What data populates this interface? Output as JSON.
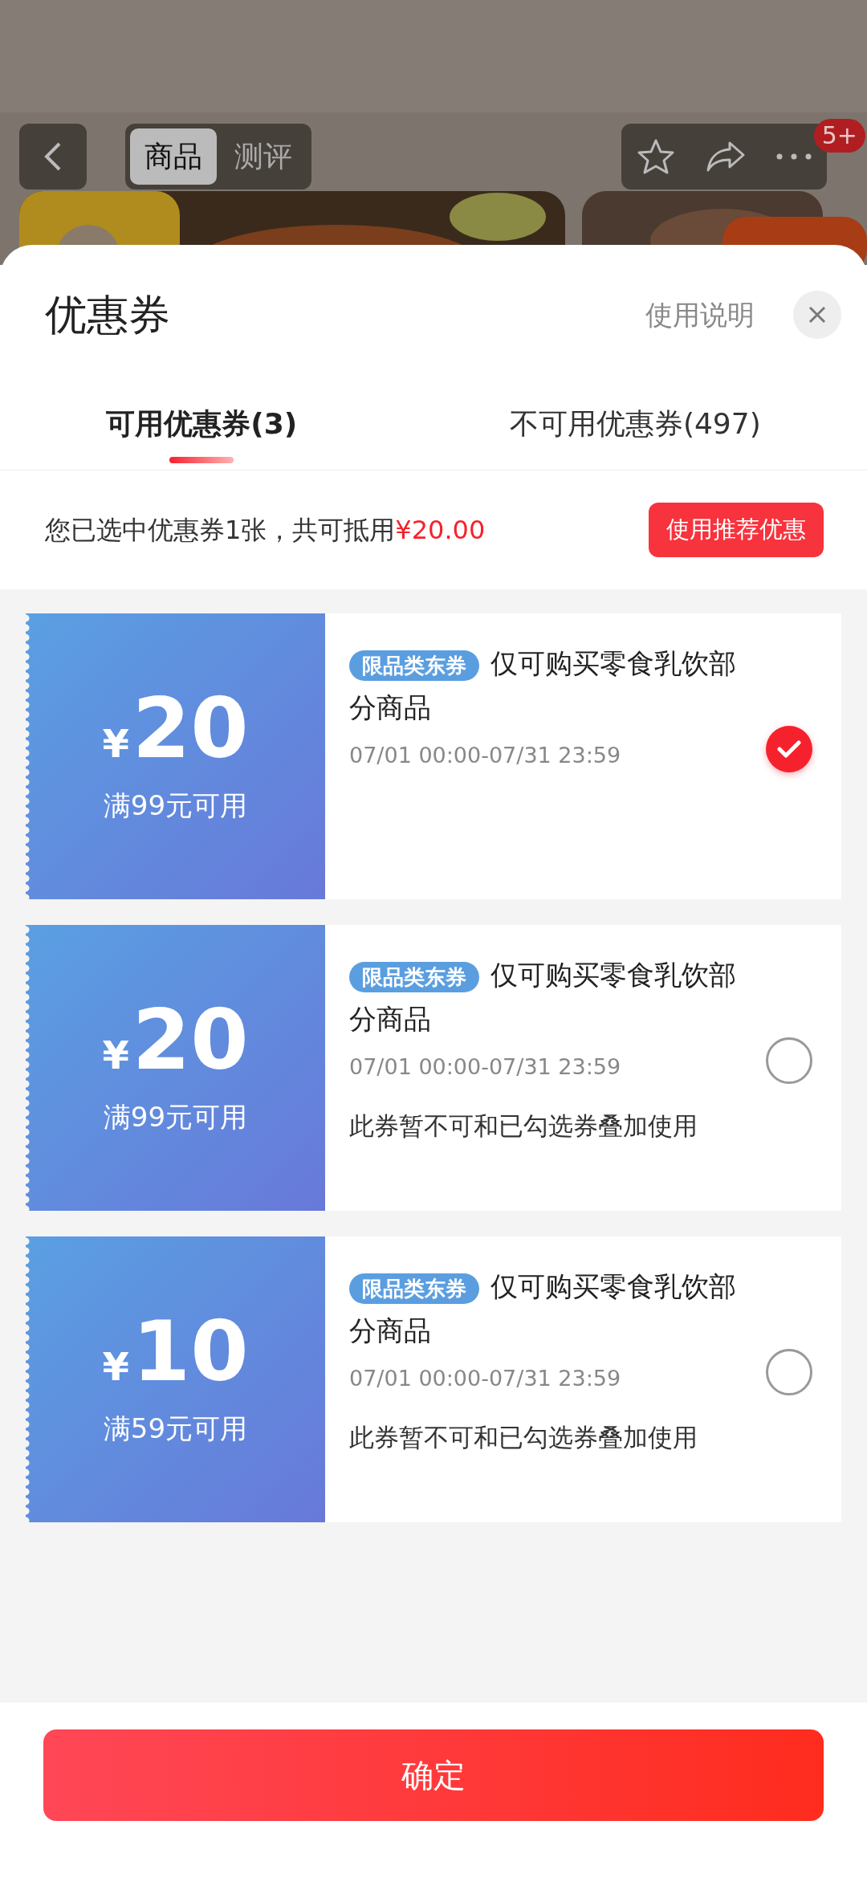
{
  "background_page": {
    "kind": "picture",
    "page_tabs": [
      {
        "label": "商品",
        "selected": true
      },
      {
        "label": "测评",
        "selected": false
      }
    ],
    "message_badge": "5+"
  },
  "sheet": {
    "title": "优惠券",
    "help_link": "使用说明",
    "tabs": [
      {
        "label": "可用优惠券(3)",
        "selected": true
      },
      {
        "label": "不可用优惠券(497)",
        "selected": false
      }
    ],
    "summary": {
      "text": "您已选中优惠券1张，共可抵用",
      "amount": "¥20.00",
      "button": "使用推荐优惠"
    },
    "coupons": [
      {
        "currency": "¥",
        "amount": "20",
        "condition": "满99元可用",
        "tag": "限品类东券",
        "title": "仅可购买零食乳饮部分商品",
        "validity": "07/01 00:00-07/31 23:59",
        "selected": true
      },
      {
        "currency": "¥",
        "amount": "20",
        "condition": "满99元可用",
        "tag": "限品类东券",
        "title": "仅可购买零食乳饮部分商品",
        "validity": "07/01 00:00-07/31 23:59",
        "note": "此券暂不可和已勾选券叠加使用",
        "selected": false
      },
      {
        "currency": "¥",
        "amount": "10",
        "condition": "满59元可用",
        "tag": "限品类东券",
        "title": "仅可购买零食乳饮部分商品",
        "validity": "07/01 00:00-07/31 23:59",
        "note": "此券暂不可和已勾选券叠加使用",
        "selected": false
      }
    ],
    "confirm_button": "确定"
  }
}
